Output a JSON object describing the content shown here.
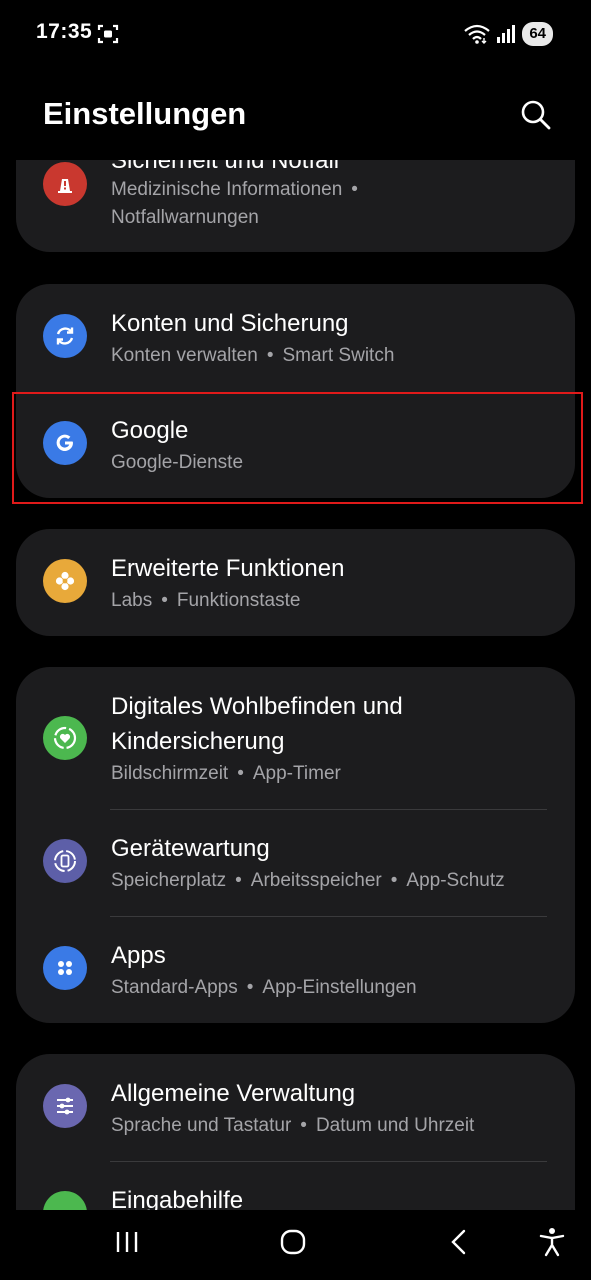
{
  "status_bar": {
    "time": "17:35",
    "battery": "64"
  },
  "header": {
    "title": "Einstellungen"
  },
  "sections": [
    {
      "items": [
        {
          "title": "Sicherheit und Notfall",
          "subtitle_line1": "Medizinische Informationen",
          "subtitle_line2": "Notfallwarnungen",
          "icon": "alert-icon",
          "icon_color": "#c9382f"
        }
      ]
    },
    {
      "items": [
        {
          "title": "Konten und Sicherung",
          "subtitle": [
            "Konten verwalten",
            "Smart Switch"
          ],
          "icon": "sync-icon",
          "icon_color": "#3a7ae6"
        },
        {
          "title": "Google",
          "subtitle": [
            "Google-Dienste"
          ],
          "icon": "google-icon",
          "icon_color": "#3a7ae6"
        }
      ]
    },
    {
      "items": [
        {
          "title": "Erweiterte Funktionen",
          "subtitle": [
            "Labs",
            "Funktionstaste"
          ],
          "icon": "advanced-features-icon",
          "icon_color": "#e8a93a"
        }
      ]
    },
    {
      "items": [
        {
          "title_line1": "Digitales Wohlbefinden und",
          "title_line2": "Kindersicherung",
          "subtitle": [
            "Bildschirmzeit",
            "App-Timer"
          ],
          "icon": "wellbeing-icon",
          "icon_color": "#4cb84f"
        },
        {
          "title": "Gerätewartung",
          "subtitle": [
            "Speicherplatz",
            "Arbeitsspeicher",
            "App-Schutz"
          ],
          "icon": "device-care-icon",
          "icon_color": "#5d5fa8"
        },
        {
          "title": "Apps",
          "subtitle": [
            "Standard-Apps",
            "App-Einstellungen"
          ],
          "icon": "apps-icon",
          "icon_color": "#3a7ae6"
        }
      ]
    },
    {
      "items": [
        {
          "title": "Allgemeine Verwaltung",
          "subtitle": [
            "Sprache und Tastatur",
            "Datum und Uhrzeit"
          ],
          "icon": "sliders-icon",
          "icon_color": "#6a67b0"
        },
        {
          "title": "Eingabehilfe",
          "icon": "accessibility-icon",
          "icon_color": "#4cb84f"
        }
      ]
    }
  ],
  "separator": "•"
}
